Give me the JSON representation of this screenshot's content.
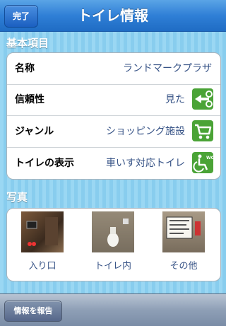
{
  "navbar": {
    "title": "トイレ情報",
    "done_label": "完了"
  },
  "sections": {
    "basic": {
      "header": "基本項目",
      "rows": [
        {
          "label": "名称",
          "value": "ランドマークプラザ"
        },
        {
          "label": "信頼性",
          "value": "見た",
          "icon": "seen-arrows-icon"
        },
        {
          "label": "ジャンル",
          "value": "ショッピング施設",
          "icon": "shopping-cart-icon"
        },
        {
          "label": "トイレの表示",
          "value": "車いす対応トイレ",
          "icon": "wheelchair-wc-icon"
        }
      ]
    },
    "photos": {
      "header": "写真",
      "items": [
        {
          "caption": "入り口",
          "icon": "entrance-photo"
        },
        {
          "caption": "トイレ内",
          "icon": "toilet-interior-photo"
        },
        {
          "caption": "その他",
          "icon": "other-photo"
        }
      ]
    }
  },
  "toolbar": {
    "report_label": "情報を報告"
  },
  "colors": {
    "accent": "#2f7fd6",
    "icon_green": "#4aa336",
    "value_text": "#385487"
  }
}
